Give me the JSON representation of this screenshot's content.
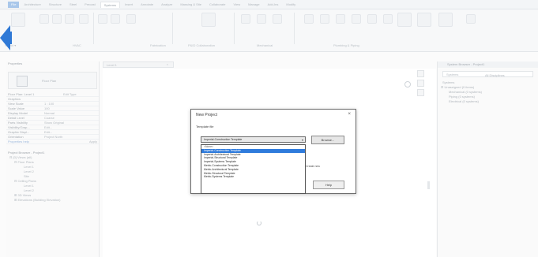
{
  "ribbon": {
    "file_tab": "File",
    "tabs": [
      "Architecture",
      "Structure",
      "Steel",
      "Precast",
      "Systems",
      "Insert",
      "Annotate",
      "Analyze",
      "Massing & Site",
      "Collaborate",
      "View",
      "Manage",
      "Add-Ins",
      "Modify"
    ],
    "active_tab": "Systems",
    "group_labels": [
      "Select ▾",
      "HVAC",
      "Fabrication",
      "P&ID Collaboration",
      "Mechanical",
      "Plumbing & Piping"
    ]
  },
  "properties": {
    "title": "Properties",
    "type_name": "Floor Plan",
    "selector": "Floor Plan: Level 1",
    "edit_type": "Edit Type",
    "rows": [
      {
        "k": "Graphics",
        "v": ""
      },
      {
        "k": "View Scale",
        "v": "1 : 100"
      },
      {
        "k": "Scale Value",
        "v": "100"
      },
      {
        "k": "Display Model",
        "v": "Normal"
      },
      {
        "k": "Detail Level",
        "v": "Coarse"
      },
      {
        "k": "Parts Visibility",
        "v": "Show Original"
      },
      {
        "k": "Visibility/Grap...",
        "v": "Edit..."
      },
      {
        "k": "Graphic Displ...",
        "v": "Edit..."
      },
      {
        "k": "Orientation",
        "v": "Project North"
      }
    ],
    "help_link": "Properties help",
    "apply": "Apply"
  },
  "project_browser_left": {
    "title": "Project Browser - Project1",
    "rows": [
      "⊟ [0] Views (all)",
      "⊟ Floor Plans",
      "Level 1",
      "Level 2",
      "Site",
      "⊟ Ceiling Plans",
      "Level 1",
      "Level 2",
      "⊞ 3D Views",
      "⊞ Elevations (Building Elevation)"
    ]
  },
  "view_tab": {
    "label": "Level 1",
    "close": "×"
  },
  "system_browser": {
    "title": "System Browser - Project1",
    "search": "Systems",
    "column": "All Disciplines",
    "rows": [
      "Systems",
      "⊟ Unassigned (0 items)",
      "Mechanical (0 systems)",
      "Piping (0 systems)",
      "Electrical (0 systems)"
    ]
  },
  "dialog": {
    "title": "New Project",
    "close": "×",
    "template_label": "Template file",
    "selected_template": "Imperial-Construction Template",
    "browse_button": "Browse...",
    "create_new_label": "Create new",
    "help_button": "Help",
    "options": [
      "<None>",
      "Imperial-Construction Template",
      "Imperial-Architectural Template",
      "Imperial-Structural Template",
      "Imperial-Systems Template",
      "Metric-Construction Template",
      "Metric-Architectural Template",
      "Metric-Structural Template",
      "Metric-Systems Template"
    ],
    "selected_index": 1
  },
  "colors": {
    "accent": "#2f7bdc",
    "file_tab": "#a9c7ea",
    "arrow": "#2f79d6"
  }
}
